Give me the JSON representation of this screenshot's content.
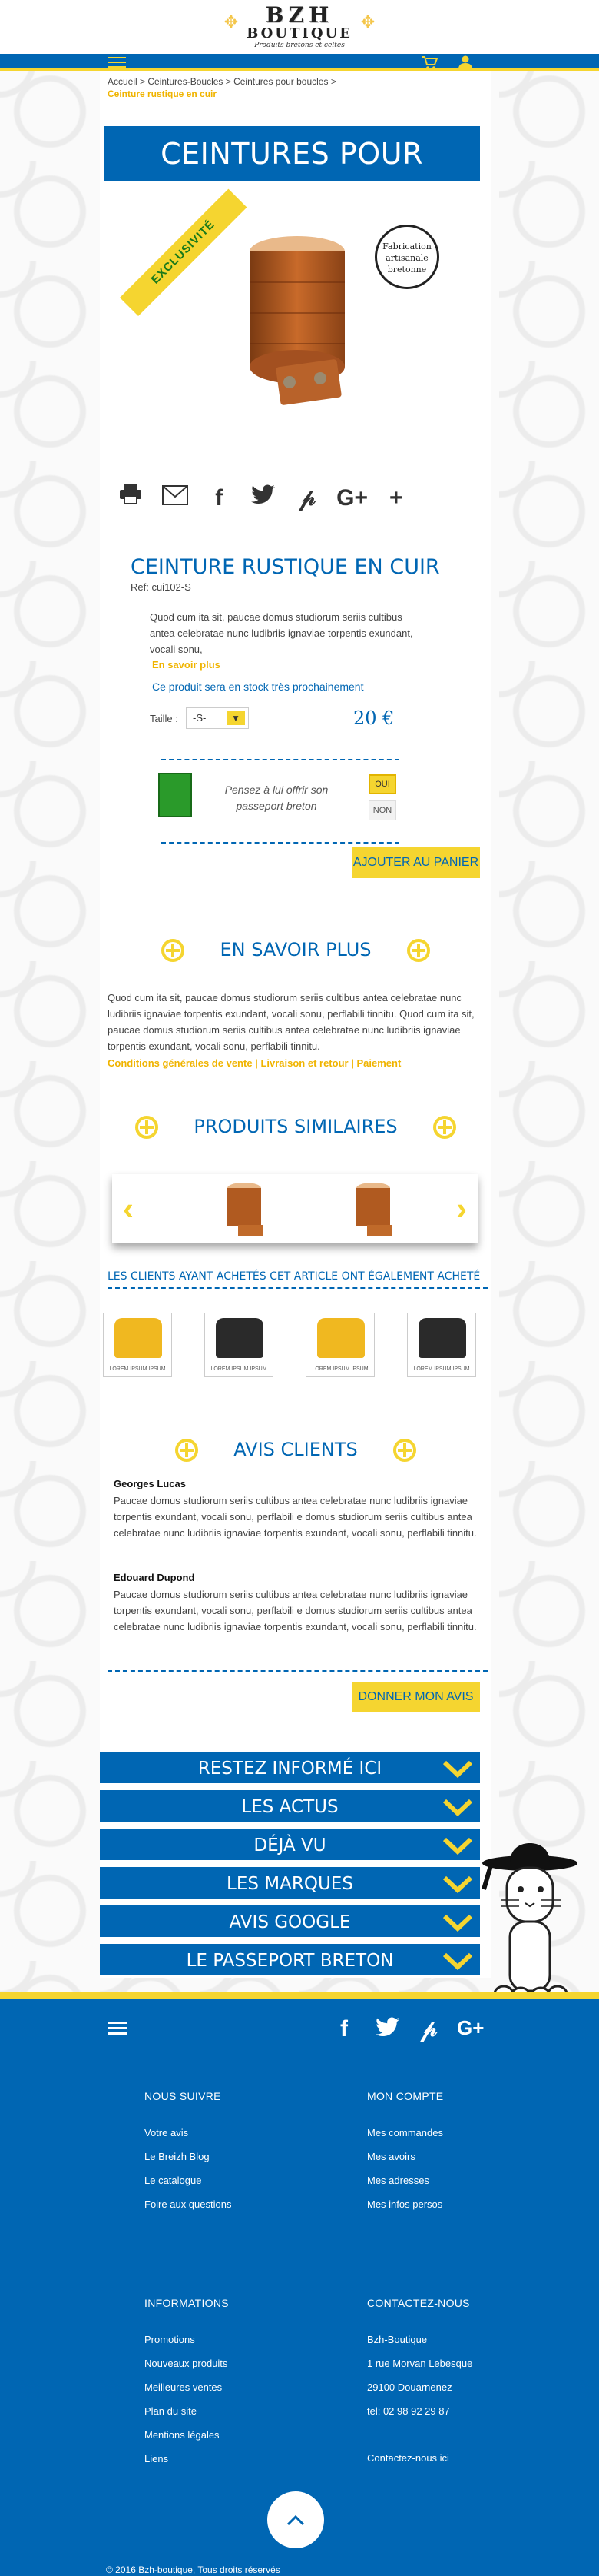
{
  "header": {
    "logo_line1": "BZH",
    "logo_line2": "BOUTIQUE",
    "logo_tagline": "Produits bretons et celtes"
  },
  "breadcrumb": {
    "path": "Accueil > Ceintures-Boucles > Ceintures pour boucles >",
    "current": "Ceinture rustique en cuir"
  },
  "category_banner": "CEINTURES POUR BOUCLES",
  "product": {
    "ribbon": "EXCLUSIVITÉ",
    "stamp": [
      "Fabrication",
      "artisanale",
      "bretonne"
    ],
    "title": "CEINTURE RUSTIQUE EN CUIR",
    "ref": "Ref: cui102-S",
    "description": "Quod cum ita sit, paucae domus studiorum seriis cultibus antea celebratae nunc ludibriis ignaviae torpentis exundant, vocali sonu,",
    "more_link": "En savoir plus",
    "stock": "Ce produit sera en stock très prochainement",
    "size_label": "Taille :",
    "size_value": "-S-",
    "price": "20 €",
    "passport_text": "Pensez à lui offrir son passeport breton",
    "oui": "OUI",
    "non": "NON",
    "cart_button": "AJOUTER AU PANIER"
  },
  "savoir_plus": {
    "title": "EN SAVOIR PLUS",
    "text": "Quod cum ita sit, paucae domus studiorum seriis cultibus antea celebratae nunc ludibriis ignaviae torpentis exundant, vocali sonu, perflabili tinnitu. Quod cum ita sit, paucae domus studiorum seriis cultibus antea celebratae nunc ludibriis ignaviae torpentis exundant, vocali sonu, perflabili tinnitu.",
    "link1": "Conditions générales de vente",
    "link2": "Livraison et retour",
    "link3": "Paiement",
    "sep": "|"
  },
  "similar": {
    "title": "PRODUITS SIMILAIRES",
    "also_bought": "LES CLIENTS AYANT ACHETÉS CET ARTICLE ONT ÉGALEMENT ACHETÉ",
    "thumb_caption": "LOREM IPSUM IPSUM"
  },
  "reviews": {
    "title": "AVIS CLIENTS",
    "items": [
      {
        "name": "Georges Lucas",
        "text": "Paucae domus studiorum seriis cultibus antea celebratae nunc ludibriis ignaviae torpentis exundant, vocali sonu, perflabili e domus studiorum seriis cultibus antea celebratae nunc ludibriis ignaviae torpentis exundant, vocali sonu, perflabili tinnitu."
      },
      {
        "name": "Edouard Dupond",
        "text": "Paucae domus studiorum seriis cultibus antea celebratae nunc ludibriis ignaviae torpentis exundant, vocali sonu, perflabili e domus studiorum seriis cultibus antea celebratae nunc ludibriis ignaviae torpentis exundant, vocali sonu, perflabili tinnitu."
      }
    ],
    "button": "DONNER MON AVIS"
  },
  "accordion": [
    "RESTEZ INFORMÉ ICI",
    "LES ACTUS",
    "DÉJÀ VU",
    "LES MARQUES",
    "AVIS GOOGLE",
    "LE PASSEPORT BRETON"
  ],
  "footer": {
    "col1": {
      "title": "NOUS SUIVRE",
      "items": [
        "Votre avis",
        "Le Breizh Blog",
        "Le catalogue",
        "Foire aux questions"
      ]
    },
    "col2": {
      "title": "MON COMPTE",
      "items": [
        "Mes commandes",
        "Mes avoirs",
        "Mes adresses",
        "Mes infos persos"
      ]
    },
    "col3": {
      "title": "INFORMATIONS",
      "items": [
        "Promotions",
        "Nouveaux produits",
        "Meilleures ventes",
        "Plan du site",
        "Mentions légales",
        "Liens"
      ]
    },
    "col4": {
      "title": "CONTACTEZ-NOUS",
      "items": [
        "Bzh-Boutique",
        "1 rue Morvan Lebesque",
        "29100 Douarnenez",
        "tel: 02 98 92 29 87",
        "",
        "Contactez-nous ici"
      ]
    },
    "copyright": "© 2016  Bzh-boutique, Tous droits réservés",
    "social": [
      "f",
      "twitter",
      "p",
      "g+"
    ]
  },
  "colors": {
    "brand_blue": "#0066b3",
    "accent_yellow": "#f5d530",
    "link_gold": "#f0b400"
  }
}
